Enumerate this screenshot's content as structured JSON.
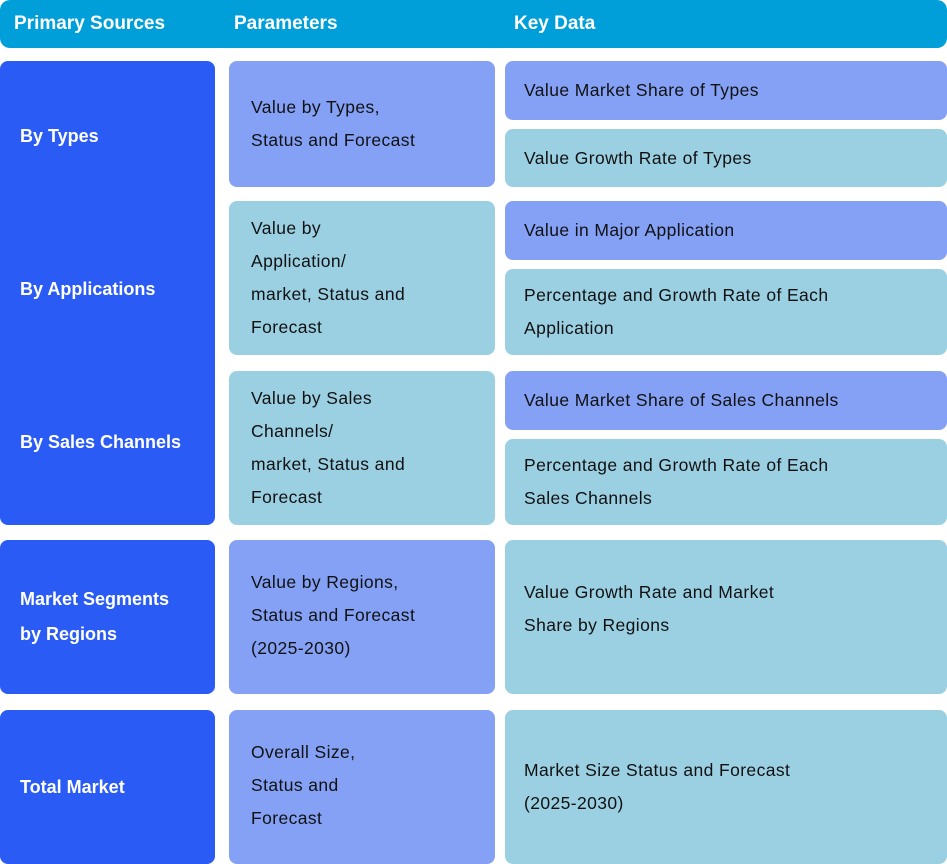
{
  "header": {
    "col1": "Primary Sources",
    "col2": "Parameters",
    "col3": "Key Data"
  },
  "colors": {
    "header_bg": "#009fd9",
    "source_bg": "#2a5cf5",
    "violet_cell": "#84a1f6",
    "cyan_cell": "#9bd0e3"
  },
  "sources": {
    "by_types": "By Types",
    "by_applications": "By Applications",
    "by_sales_channels": "By Sales Channels",
    "regions_line1": "Market Segments",
    "regions_line2": "by Regions",
    "total_market": "Total Market"
  },
  "parameters": {
    "types": [
      "Value by Types,",
      "Status and Forecast"
    ],
    "applications": [
      "Value by",
      "Application/",
      "market, Status and",
      "Forecast"
    ],
    "sales_channels": [
      "Value by Sales",
      "Channels/",
      "market, Status and",
      "Forecast"
    ],
    "regions": [
      "Value by Regions,",
      "Status and Forecast",
      "(2025-2030)"
    ],
    "total": [
      "Overall Size,",
      "Status and",
      "Forecast"
    ]
  },
  "key_data": {
    "types_share": "Value Market Share of Types",
    "types_growth": "Value Growth Rate of Types",
    "app_major": "Value in Major Application",
    "app_growth": [
      "Percentage and Growth Rate of Each",
      "Application"
    ],
    "sales_share": "Value Market Share of Sales Channels",
    "sales_growth": [
      "Percentage and Growth Rate of Each",
      "Sales Channels"
    ],
    "regions": [
      "Value Growth Rate and Market",
      "Share by Regions"
    ],
    "total": [
      "Market Size Status and Forecast",
      "(2025-2030)"
    ]
  }
}
